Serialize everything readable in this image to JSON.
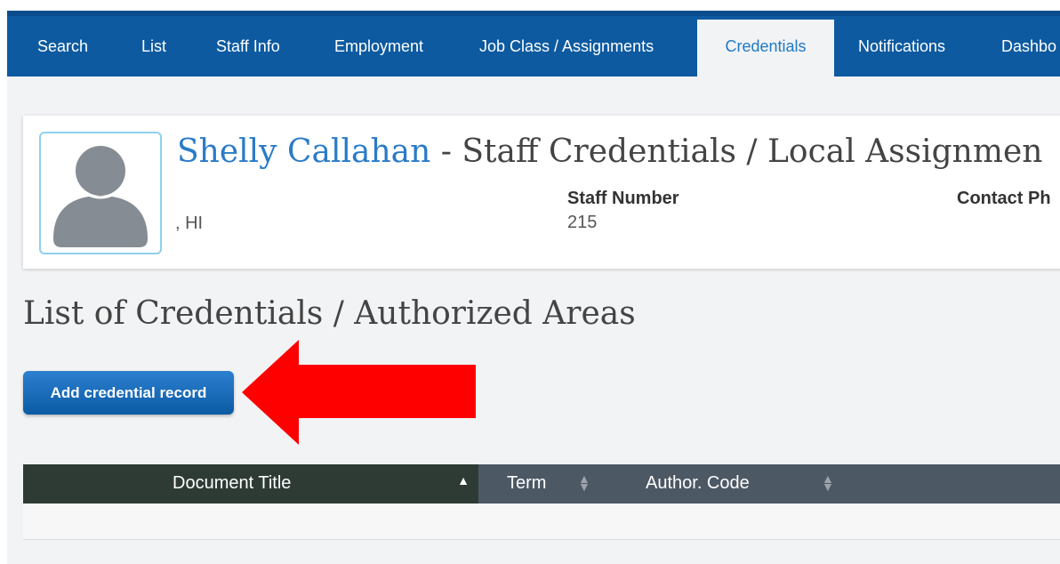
{
  "nav": {
    "tabs": [
      {
        "label": "Search"
      },
      {
        "label": "List"
      },
      {
        "label": "Staff Info"
      },
      {
        "label": "Employment"
      },
      {
        "label": "Job Class / Assignments"
      },
      {
        "label": "Credentials"
      },
      {
        "label": "Notifications"
      },
      {
        "label": "Dashbo"
      }
    ],
    "active_tab": "Credentials"
  },
  "header": {
    "name": "Shelly Callahan",
    "title_suffix": " - Staff Credentials / Local Assignmen",
    "location": ", HI",
    "staff_number_label": "Staff Number",
    "staff_number_value": "215",
    "contact_label": "Contact Ph"
  },
  "section": {
    "title": "List of Credentials / Authorized Areas",
    "add_button_label": "Add credential record"
  },
  "table": {
    "columns": [
      {
        "label": "Document Title",
        "sort": "ascending"
      },
      {
        "label": "Term",
        "sort": "none"
      },
      {
        "label": "Author. Code",
        "sort": "none"
      }
    ],
    "rows": []
  },
  "colors": {
    "nav_bg": "#0d5aa0",
    "link": "#2a7bc8",
    "button": "#0a5aa3",
    "annotation_arrow": "#ff0000"
  }
}
